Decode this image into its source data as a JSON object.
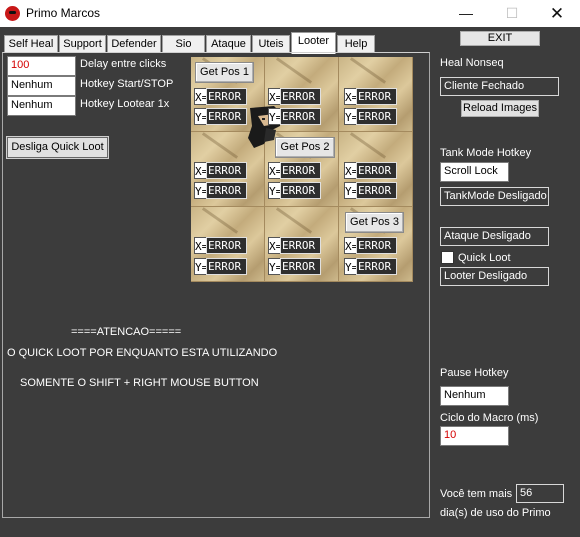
{
  "window": {
    "title": "Primo Marcos",
    "minimize": "—",
    "maximize": "☐",
    "close": "✕"
  },
  "tabs": [
    {
      "label": "Self Heal"
    },
    {
      "label": "Support"
    },
    {
      "label": "Defender"
    },
    {
      "label": "Sio"
    },
    {
      "label": "Ataque"
    },
    {
      "label": "Uteis"
    },
    {
      "label": "Looter"
    },
    {
      "label": "Help"
    }
  ],
  "active_tab": "Looter",
  "looter": {
    "delay_value": "100",
    "delay_label": "Delay entre clicks",
    "hotkey_start_value": "Nenhum",
    "hotkey_start_label": "Hotkey Start/STOP",
    "hotkey_loot_value": "Nenhum",
    "hotkey_loot_label": "Hotkey Lootear 1x",
    "quick_loot_button": "Desliga Quick Loot",
    "get_pos_1": "Get Pos 1",
    "get_pos_2": "Get Pos 2",
    "get_pos_3": "Get Pos 3",
    "coord_x_key": "X=",
    "coord_y_key": "Y=",
    "coord_value": "ERROR",
    "attention_title": "====ATENCAO=====",
    "attention_line1": "O QUICK LOOT POR ENQUANTO ESTA UTILIZANDO",
    "attention_line2": "SOMENTE O SHIFT + RIGHT MOUSE BUTTON"
  },
  "right": {
    "exit_label": "EXIT",
    "heal_nonseq_label": "Heal Nonseq",
    "client_status": "Cliente Fechado",
    "reload_images": "Reload Images",
    "tank_mode_hotkey_label": "Tank Mode Hotkey",
    "tank_mode_hotkey_value": "Scroll Lock",
    "tank_mode_status": "TankMode Desligado",
    "ataque_status": "Ataque Desligado",
    "quick_loot_checkbox_label": "Quick Loot",
    "looter_status": "Looter Desligado",
    "pause_hotkey_label": "Pause Hotkey",
    "pause_hotkey_value": "Nenhum",
    "ciclo_label": "Ciclo do Macro (ms)",
    "ciclo_value": "10",
    "days_prefix": "Você tem mais",
    "days_value": "56",
    "days_suffix": "dia(s) de uso do Primo"
  },
  "colors": {
    "background": "#3c3c3c",
    "error_red": "#d40000",
    "titlebar": "#ffffff"
  },
  "icons": [
    "app-skull-icon",
    "minimize-icon",
    "maximize-icon",
    "close-icon",
    "character-sprite"
  ]
}
